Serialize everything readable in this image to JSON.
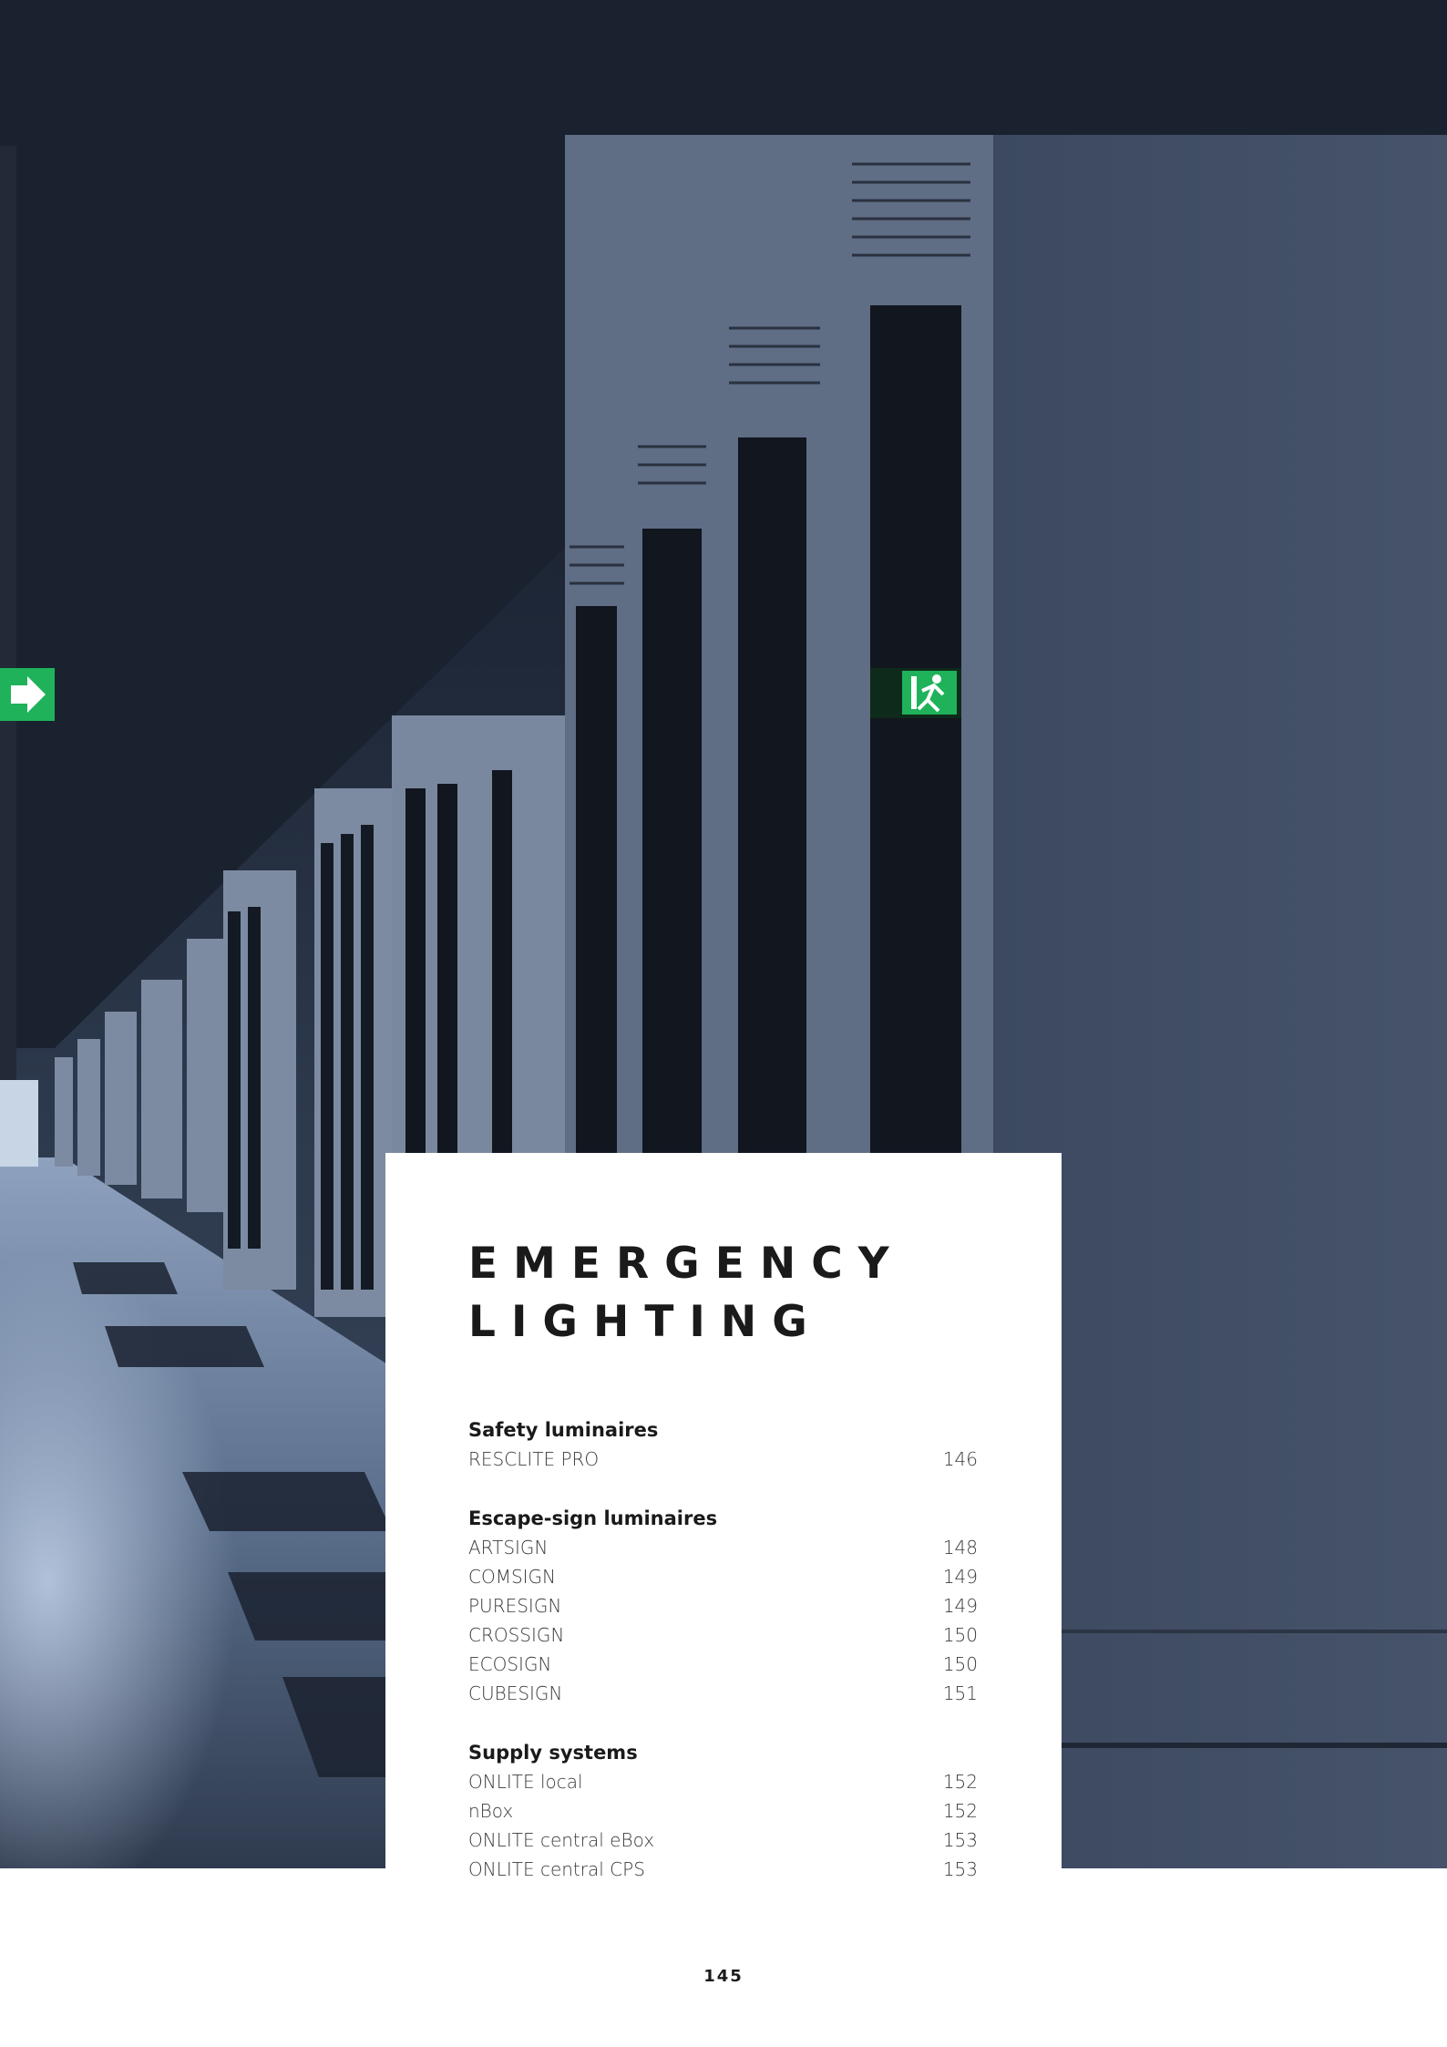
{
  "title_lines": [
    "EMERGENCY",
    "LIGHTING"
  ],
  "sections": [
    {
      "heading": "Safety luminaires",
      "items": [
        {
          "name": "RESCLITE PRO",
          "page": "146"
        }
      ]
    },
    {
      "heading": "Escape-sign luminaires",
      "items": [
        {
          "name": "ARTSIGN",
          "page": "148"
        },
        {
          "name": "COMSIGN",
          "page": "149"
        },
        {
          "name": "PURESIGN",
          "page": "149"
        },
        {
          "name": "CROSSIGN",
          "page": "150"
        },
        {
          "name": "ECOSIGN",
          "page": "150"
        },
        {
          "name": "CUBESIGN",
          "page": "151"
        }
      ]
    },
    {
      "heading": "Supply systems",
      "items": [
        {
          "name": "ONLITE local",
          "page": "152"
        },
        {
          "name": "nBox",
          "page": "152"
        },
        {
          "name": "ONLITE central eBox",
          "page": "153"
        },
        {
          "name": "ONLITE central CPS",
          "page": "153"
        }
      ]
    }
  ],
  "page_number": "145",
  "colors": {
    "exit_sign_green": "#1fb25a",
    "text_dark": "#1a1a1a",
    "photo_dark": "#1f2838"
  }
}
